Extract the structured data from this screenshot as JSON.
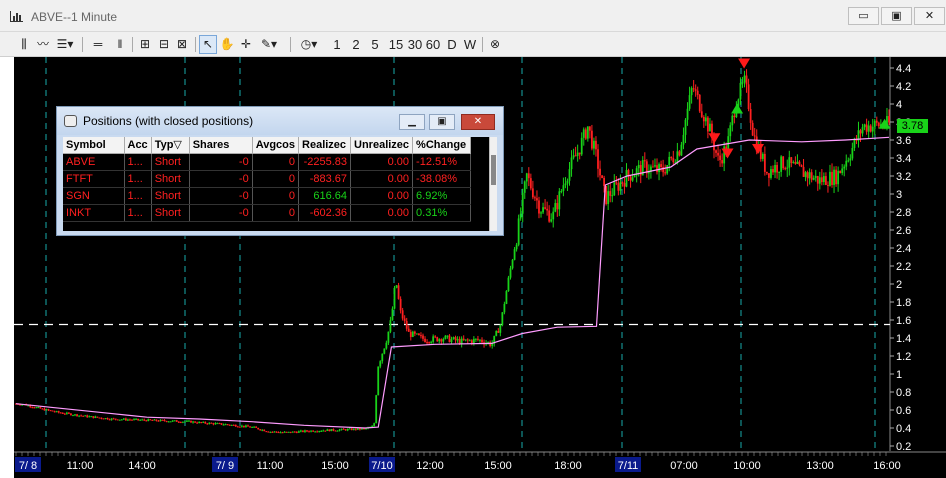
{
  "window": {
    "title": "ABVE--1 Minute",
    "buttons": [
      "▭",
      "▣",
      "✕"
    ]
  },
  "toolbar": {
    "periods": [
      "1",
      "2",
      "5",
      "15",
      "30",
      "60",
      "D",
      "W"
    ]
  },
  "chart_data": {
    "type": "candlestick",
    "symbol": "ABVE",
    "interval": "1 Minute",
    "x_ticks": [
      "7/ 8",
      "11:00",
      "14:00",
      "7/ 9",
      "11:00",
      "15:00",
      "7/10",
      "12:00",
      "15:00",
      "18:00",
      "7/11",
      "07:00",
      "10:00",
      "13:00",
      "16:00"
    ],
    "date_ticks": [
      "7/ 8",
      "7/ 9",
      "7/10",
      "7/11"
    ],
    "y_ticks": [
      "4.4",
      "4.2",
      "4",
      "3.8",
      "3.6",
      "3.4",
      "3.2",
      "3",
      "2.8",
      "2.6",
      "2.4",
      "2.2",
      "2",
      "1.8",
      "1.6",
      "1.4",
      "1.2",
      "1",
      "0.8",
      "0.6",
      "0.4",
      "0.2"
    ],
    "ylim": [
      0.2,
      4.4
    ],
    "last_price": "3.78",
    "dashed_level": 1.55,
    "price_path": [
      [
        0.0,
        0.67
      ],
      [
        0.01,
        0.66
      ],
      [
        0.03,
        0.61
      ],
      [
        0.05,
        0.57
      ],
      [
        0.08,
        0.53
      ],
      [
        0.11,
        0.5
      ],
      [
        0.14,
        0.49
      ],
      [
        0.17,
        0.48
      ],
      [
        0.2,
        0.47
      ],
      [
        0.21,
        0.46
      ],
      [
        0.24,
        0.44
      ],
      [
        0.27,
        0.41
      ],
      [
        0.29,
        0.36
      ],
      [
        0.31,
        0.35
      ],
      [
        0.34,
        0.37
      ],
      [
        0.37,
        0.38
      ],
      [
        0.4,
        0.39
      ],
      [
        0.41,
        0.42
      ],
      [
        0.415,
        1.1
      ],
      [
        0.425,
        1.4
      ],
      [
        0.43,
        1.62
      ],
      [
        0.435,
        2.05
      ],
      [
        0.44,
        1.7
      ],
      [
        0.45,
        1.45
      ],
      [
        0.47,
        1.38
      ],
      [
        0.49,
        1.4
      ],
      [
        0.51,
        1.36
      ],
      [
        0.53,
        1.38
      ],
      [
        0.545,
        1.33
      ],
      [
        0.555,
        1.55
      ],
      [
        0.565,
        2.1
      ],
      [
        0.575,
        2.6
      ],
      [
        0.585,
        3.2
      ],
      [
        0.6,
        2.85
      ],
      [
        0.615,
        2.75
      ],
      [
        0.63,
        3.2
      ],
      [
        0.645,
        3.5
      ],
      [
        0.655,
        3.75
      ],
      [
        0.665,
        3.4
      ],
      [
        0.675,
        2.95
      ],
      [
        0.685,
        3.05
      ],
      [
        0.7,
        3.2
      ],
      [
        0.72,
        3.3
      ],
      [
        0.74,
        3.25
      ],
      [
        0.76,
        3.5
      ],
      [
        0.775,
        4.2
      ],
      [
        0.785,
        3.95
      ],
      [
        0.795,
        3.7
      ],
      [
        0.805,
        3.35
      ],
      [
        0.815,
        3.55
      ],
      [
        0.825,
        4.05
      ],
      [
        0.835,
        4.25
      ],
      [
        0.845,
        3.65
      ],
      [
        0.86,
        3.25
      ],
      [
        0.88,
        3.35
      ],
      [
        0.9,
        3.25
      ],
      [
        0.92,
        3.15
      ],
      [
        0.94,
        3.2
      ],
      [
        0.955,
        3.45
      ],
      [
        0.97,
        3.75
      ],
      [
        1.0,
        3.78
      ]
    ],
    "vwap_path": [
      [
        0.0,
        0.67
      ],
      [
        0.04,
        0.63
      ],
      [
        0.1,
        0.57
      ],
      [
        0.15,
        0.52
      ],
      [
        0.21,
        0.5
      ],
      [
        0.27,
        0.47
      ],
      [
        0.33,
        0.43
      ],
      [
        0.4,
        0.4
      ],
      [
        0.415,
        0.41
      ],
      [
        0.43,
        1.3
      ],
      [
        0.48,
        1.33
      ],
      [
        0.545,
        1.34
      ],
      [
        0.58,
        1.45
      ],
      [
        0.62,
        1.52
      ],
      [
        0.665,
        1.53
      ],
      [
        0.675,
        3.1
      ],
      [
        0.7,
        3.2
      ],
      [
        0.75,
        3.3
      ],
      [
        0.78,
        3.5
      ],
      [
        0.84,
        3.6
      ],
      [
        0.9,
        3.58
      ],
      [
        0.95,
        3.6
      ],
      [
        1.0,
        3.63
      ]
    ],
    "markers": [
      {
        "type": "sell",
        "x": 0.834,
        "y": 4.45
      },
      {
        "type": "buy",
        "x": 0.826,
        "y": 3.95
      },
      {
        "type": "sell",
        "x": 0.8,
        "y": 3.62
      },
      {
        "type": "sell",
        "x": 0.815,
        "y": 3.45
      },
      {
        "type": "sell",
        "x": 0.85,
        "y": 3.5
      },
      {
        "type": "buy",
        "x": 0.995,
        "y": 3.78
      }
    ]
  },
  "colors": {
    "up": "#19d319",
    "down": "#ff2020",
    "vwap": "#ff9cff",
    "grid_dashed": "#1ec8c8",
    "date_label_bg": "#0a1a8c",
    "buy_marker": "#19d319",
    "sell_marker": "#ff1a1a"
  },
  "positions": {
    "title": "Positions (with closed positions)",
    "columns": [
      "Symbol",
      "Acc",
      "Typ▽",
      "Shares",
      "Avgcos",
      "Realizec",
      "Unrealizec",
      "%Change"
    ],
    "rows": [
      {
        "symbol": "ABVE",
        "acc": "1...",
        "typ": "Short",
        "shares": "-0",
        "avgcost": "0",
        "realized": "-2255.83",
        "unrealized": "0.00",
        "pct": "-12.51%",
        "realized_color": "#ff2020",
        "pct_color": "#ff2020"
      },
      {
        "symbol": "FTFT",
        "acc": "1...",
        "typ": "Short",
        "shares": "-0",
        "avgcost": "0",
        "realized": "-883.67",
        "unrealized": "0.00",
        "pct": "-38.08%",
        "realized_color": "#ff2020",
        "pct_color": "#ff2020"
      },
      {
        "symbol": "SGN",
        "acc": "1...",
        "typ": "Short",
        "shares": "-0",
        "avgcost": "0",
        "realized": "616.64",
        "unrealized": "0.00",
        "pct": "6.92%",
        "realized_color": "#19d319",
        "pct_color": "#19d319"
      },
      {
        "symbol": "INKT",
        "acc": "1...",
        "typ": "Short",
        "shares": "-0",
        "avgcost": "0",
        "realized": "-602.36",
        "unrealized": "0.00",
        "pct": "0.31%",
        "realized_color": "#ff2020",
        "pct_color": "#19d319"
      }
    ]
  }
}
